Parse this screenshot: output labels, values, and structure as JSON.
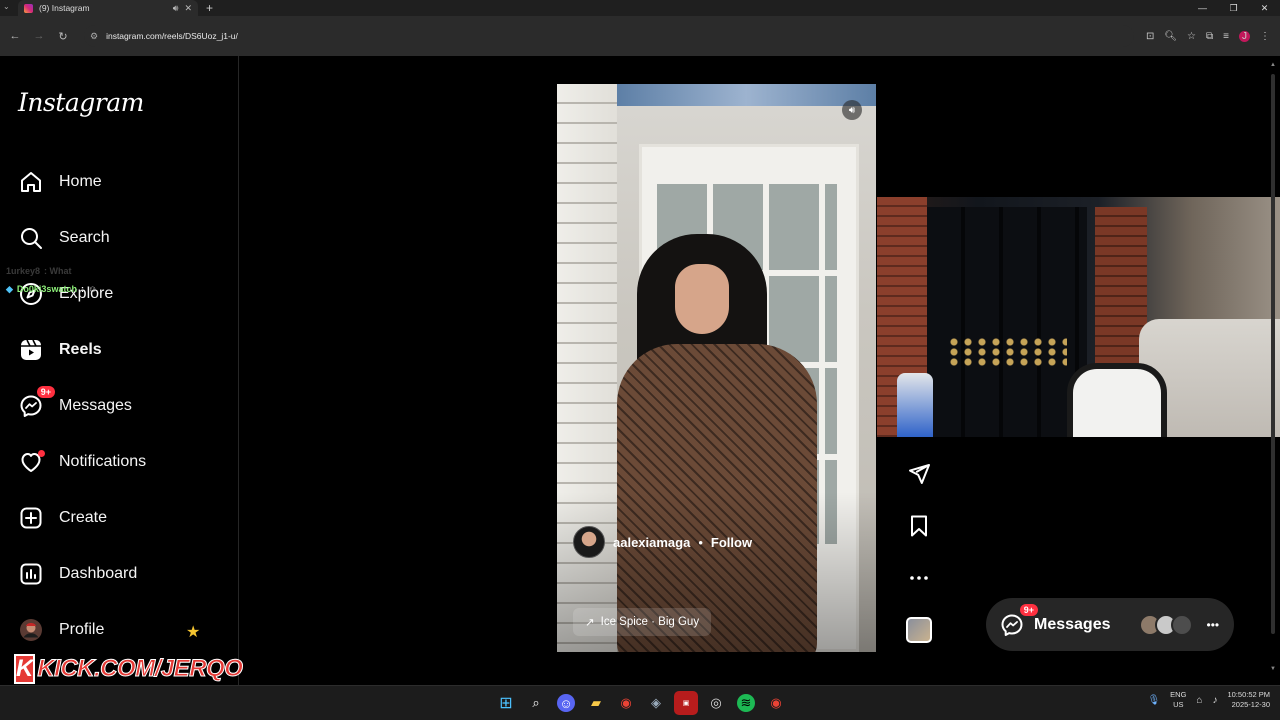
{
  "browser": {
    "tab_title": "(9) Instagram",
    "url": "instagram.com/reels/DS6Uoz_j1-u/"
  },
  "sidebar": {
    "logo": "Instagram",
    "items": [
      {
        "label": "Home",
        "icon": "home-icon"
      },
      {
        "label": "Search",
        "icon": "search-icon"
      },
      {
        "label": "Explore",
        "icon": "explore-icon"
      },
      {
        "label": "Reels",
        "icon": "reels-icon",
        "active": true
      },
      {
        "label": "Messages",
        "icon": "messages-icon",
        "badge": "9+"
      },
      {
        "label": "Notifications",
        "icon": "heart-icon",
        "dot": true
      },
      {
        "label": "Create",
        "icon": "plus-square-icon"
      },
      {
        "label": "Dashboard",
        "icon": "dashboard-icon"
      },
      {
        "label": "Profile",
        "icon": "avatar"
      }
    ]
  },
  "chat_overlay": {
    "line1_user": "1urkey8",
    "line1_text": ": What",
    "line2_user": "Do0ki3swatch",
    "line2_text": ":"
  },
  "stream_overlay": {
    "kick_logo": "K",
    "kick_text": "KICK.COM/JERQO"
  },
  "reel": {
    "author": "aalexiamaga",
    "separator": "•",
    "follow": "Follow",
    "audio_arrow": "↗",
    "audio": "Ice Spice · Big Guy"
  },
  "messages_pill": {
    "label": "Messages",
    "badge": "9+"
  },
  "taskbar": {
    "lang_top": "ENG",
    "lang_bottom": "US",
    "time": "10:50:52 PM",
    "date": "2025-12-30"
  },
  "colors": {
    "badge_red": "#ff3040",
    "background": "#000000",
    "panel": "#262626"
  }
}
